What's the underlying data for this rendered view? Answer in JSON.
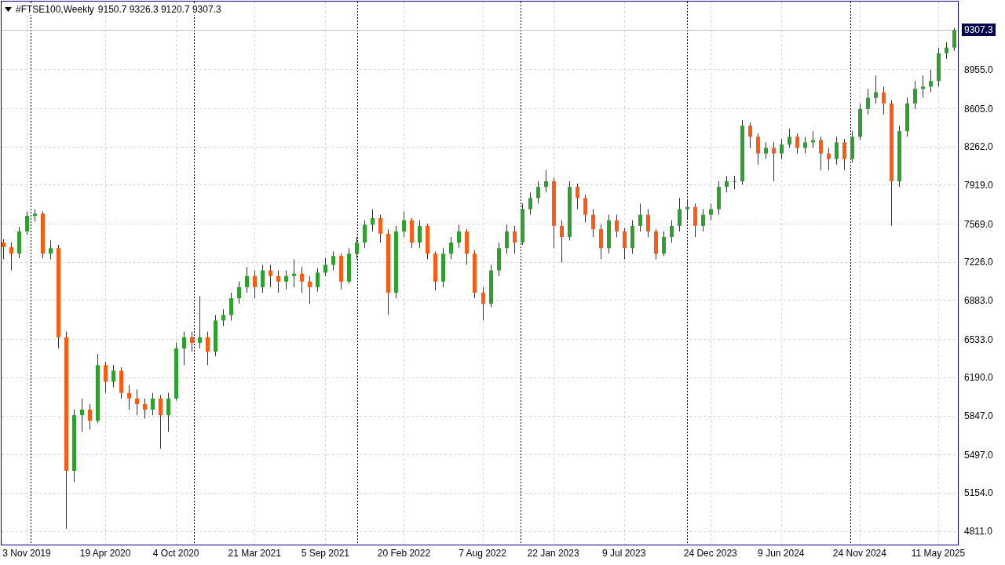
{
  "chart": {
    "symbol": "#FTSE100,Weekly",
    "quote": "9150.7 9326.3 9120.7 9307.3",
    "current_price": "9307.3",
    "chart_data": {
      "type": "candlestick",
      "ylim": [
        4674,
        9564
      ],
      "grid": true,
      "ref_lines": [
        {
          "axis": "y",
          "value": 9307.3,
          "color": "#c0c0c0"
        }
      ],
      "categories": [
        null,
        null,
        null,
        "3 Nov 2019",
        null,
        null,
        null,
        null,
        null,
        null,
        null,
        null,
        null,
        "19 Apr 2020",
        null,
        null,
        null,
        null,
        null,
        null,
        null,
        null,
        "4 Oct 2020",
        null,
        null,
        null,
        null,
        null,
        null,
        null,
        null,
        null,
        "21 Mar 2021",
        null,
        null,
        null,
        null,
        null,
        null,
        null,
        null,
        "5 Sep 2021",
        null,
        null,
        null,
        null,
        null,
        null,
        null,
        null,
        null,
        "20 Feb 2022",
        null,
        null,
        null,
        null,
        null,
        null,
        null,
        null,
        null,
        "7 Aug 2022",
        null,
        null,
        null,
        null,
        null,
        null,
        null,
        null,
        "22 Jan 2023",
        null,
        null,
        null,
        null,
        null,
        null,
        null,
        null,
        "9 Jul 2023",
        null,
        null,
        null,
        null,
        null,
        null,
        null,
        null,
        null,
        null,
        "24 Dec 2023",
        null,
        null,
        null,
        null,
        null,
        null,
        null,
        null,
        "9 Jun 2024",
        null,
        null,
        null,
        null,
        null,
        null,
        null,
        null,
        null,
        "24 Nov 2024",
        null,
        null,
        null,
        null,
        null,
        null,
        null,
        null,
        null,
        "11 May 2025",
        null,
        null
      ],
      "ohlc": [
        [
          7400,
          7430,
          7250,
          7360
        ],
        [
          7360,
          7400,
          7150,
          7300
        ],
        [
          7300,
          7540,
          7260,
          7500
        ],
        [
          7500,
          7680,
          7470,
          7640
        ],
        [
          7640,
          7700,
          7590,
          7660
        ],
        [
          7660,
          7680,
          7260,
          7300
        ],
        [
          7300,
          7420,
          7250,
          7350
        ],
        [
          7350,
          7380,
          6450,
          6550
        ],
        [
          6550,
          6600,
          4830,
          5350
        ],
        [
          5350,
          5900,
          5250,
          5850
        ],
        [
          5850,
          6000,
          5700,
          5900
        ],
        [
          5900,
          5950,
          5720,
          5800
        ],
        [
          5800,
          6400,
          5780,
          6300
        ],
        [
          6300,
          6330,
          6050,
          6150
        ],
        [
          6150,
          6300,
          6100,
          6250
        ],
        [
          6250,
          6280,
          6000,
          6050
        ],
        [
          6050,
          6120,
          5900,
          6000
        ],
        [
          6000,
          6080,
          5850,
          5950
        ],
        [
          5950,
          6000,
          5820,
          5900
        ],
        [
          5900,
          6050,
          5850,
          6000
        ],
        [
          6000,
          6030,
          5550,
          5850
        ],
        [
          5850,
          6050,
          5700,
          6000
        ],
        [
          6000,
          6500,
          5980,
          6450
        ],
        [
          6450,
          6600,
          6300,
          6550
        ],
        [
          6550,
          6600,
          6420,
          6500
        ],
        [
          6500,
          6920,
          6450,
          6550
        ],
        [
          6550,
          6600,
          6300,
          6420
        ],
        [
          6420,
          6750,
          6380,
          6700
        ],
        [
          6700,
          6800,
          6650,
          6750
        ],
        [
          6750,
          6950,
          6700,
          6900
        ],
        [
          6900,
          7050,
          6850,
          7000
        ],
        [
          7000,
          7180,
          6950,
          7100
        ],
        [
          7100,
          7150,
          6900,
          7000
        ],
        [
          7000,
          7200,
          6950,
          7150
        ],
        [
          7150,
          7200,
          7000,
          7100
        ],
        [
          7100,
          7150,
          6950,
          7050
        ],
        [
          7050,
          7150,
          6980,
          7100
        ],
        [
          7100,
          7250,
          7000,
          7120
        ],
        [
          7120,
          7180,
          6950,
          7050
        ],
        [
          7050,
          7100,
          6850,
          7000
        ],
        [
          7000,
          7170,
          6960,
          7130
        ],
        [
          7130,
          7260,
          7100,
          7200
        ],
        [
          7200,
          7320,
          7150,
          7280
        ],
        [
          7280,
          7300,
          6980,
          7050
        ],
        [
          7050,
          7350,
          7030,
          7300
        ],
        [
          7300,
          7450,
          7250,
          7400
        ],
        [
          7400,
          7600,
          7350,
          7560
        ],
        [
          7560,
          7700,
          7500,
          7620
        ],
        [
          7620,
          7650,
          7400,
          7480
        ],
        [
          7480,
          7520,
          6750,
          6950
        ],
        [
          6950,
          7550,
          6900,
          7500
        ],
        [
          7500,
          7680,
          7450,
          7600
        ],
        [
          7600,
          7620,
          7350,
          7400
        ],
        [
          7400,
          7600,
          7350,
          7550
        ],
        [
          7550,
          7570,
          7250,
          7300
        ],
        [
          7300,
          7320,
          6970,
          7050
        ],
        [
          7050,
          7350,
          7000,
          7300
        ],
        [
          7300,
          7450,
          7250,
          7400
        ],
        [
          7400,
          7560,
          7350,
          7500
        ],
        [
          7500,
          7520,
          7200,
          7300
        ],
        [
          7300,
          7330,
          6900,
          6950
        ],
        [
          6950,
          7000,
          6700,
          6850
        ],
        [
          6850,
          7200,
          6820,
          7150
        ],
        [
          7150,
          7400,
          7100,
          7350
        ],
        [
          7350,
          7560,
          7300,
          7500
        ],
        [
          7500,
          7550,
          7300,
          7400
        ],
        [
          7400,
          7750,
          7380,
          7700
        ],
        [
          7700,
          7850,
          7650,
          7800
        ],
        [
          7800,
          7950,
          7750,
          7900
        ],
        [
          7900,
          8050,
          7850,
          7950
        ],
        [
          7950,
          7980,
          7350,
          7550
        ],
        [
          7550,
          7600,
          7220,
          7450
        ],
        [
          7450,
          7950,
          7420,
          7900
        ],
        [
          7900,
          7930,
          7700,
          7800
        ],
        [
          7800,
          7830,
          7580,
          7650
        ],
        [
          7650,
          7700,
          7450,
          7520
        ],
        [
          7520,
          7560,
          7250,
          7350
        ],
        [
          7350,
          7650,
          7300,
          7600
        ],
        [
          7600,
          7650,
          7450,
          7500
        ],
        [
          7500,
          7530,
          7250,
          7350
        ],
        [
          7350,
          7600,
          7300,
          7550
        ],
        [
          7550,
          7750,
          7500,
          7650
        ],
        [
          7650,
          7700,
          7450,
          7500
        ],
        [
          7500,
          7520,
          7250,
          7300
        ],
        [
          7300,
          7500,
          7280,
          7450
        ],
        [
          7450,
          7600,
          7400,
          7550
        ],
        [
          7550,
          7800,
          7500,
          7700
        ],
        [
          7700,
          7780,
          7620,
          7720
        ],
        [
          7720,
          7750,
          7450,
          7550
        ],
        [
          7550,
          7700,
          7500,
          7650
        ],
        [
          7650,
          7750,
          7600,
          7700
        ],
        [
          7700,
          7950,
          7650,
          7900
        ],
        [
          7900,
          8000,
          7850,
          7950
        ],
        [
          7950,
          8000,
          7880,
          7950
        ],
        [
          7950,
          8500,
          7920,
          8450
        ],
        [
          8450,
          8480,
          8250,
          8350
        ],
        [
          8350,
          8380,
          8100,
          8200
        ],
        [
          8200,
          8300,
          8150,
          8250
        ],
        [
          8250,
          8300,
          7950,
          8200
        ],
        [
          8200,
          8330,
          8150,
          8280
        ],
        [
          8280,
          8420,
          8250,
          8350
        ],
        [
          8350,
          8380,
          8200,
          8250
        ],
        [
          8250,
          8350,
          8200,
          8300
        ],
        [
          8300,
          8400,
          8250,
          8320
        ],
        [
          8320,
          8350,
          8050,
          8200
        ],
        [
          8200,
          8250,
          8050,
          8150
        ],
        [
          8150,
          8350,
          8100,
          8300
        ],
        [
          8300,
          8330,
          8050,
          8150
        ],
        [
          8150,
          8400,
          8120,
          8350
        ],
        [
          8350,
          8650,
          8320,
          8600
        ],
        [
          8600,
          8780,
          8550,
          8700
        ],
        [
          8700,
          8900,
          8650,
          8750
        ],
        [
          8750,
          8800,
          8550,
          8650
        ],
        [
          8650,
          8680,
          7550,
          7950
        ],
        [
          7950,
          8450,
          7900,
          8400
        ],
        [
          8400,
          8700,
          8350,
          8650
        ],
        [
          8650,
          8850,
          8600,
          8780
        ],
        [
          8780,
          8900,
          8700,
          8800
        ],
        [
          8800,
          8950,
          8750,
          8850
        ],
        [
          8850,
          9150,
          8800,
          9100
        ],
        [
          9100,
          9200,
          9050,
          9150.7
        ],
        [
          9150.7,
          9326.3,
          9120.7,
          9307.3
        ]
      ],
      "yticks": [
        {
          "value": 8955,
          "label": "8955.0"
        },
        {
          "value": 8605,
          "label": "8605.0"
        },
        {
          "value": 8262,
          "label": "8262.0"
        },
        {
          "value": 7919,
          "label": "7919.0"
        },
        {
          "value": 7569,
          "label": "7569.0"
        },
        {
          "value": 7226,
          "label": "7226.0"
        },
        {
          "value": 6883,
          "label": "6883.0"
        },
        {
          "value": 6533,
          "label": "6533.0"
        },
        {
          "value": 6190,
          "label": "6190.0"
        },
        {
          "value": 5847,
          "label": "5847.0"
        },
        {
          "value": 5497,
          "label": "5497.0"
        },
        {
          "value": 5154,
          "label": "5154.0"
        },
        {
          "value": 4811,
          "label": "4811.0"
        }
      ]
    }
  }
}
